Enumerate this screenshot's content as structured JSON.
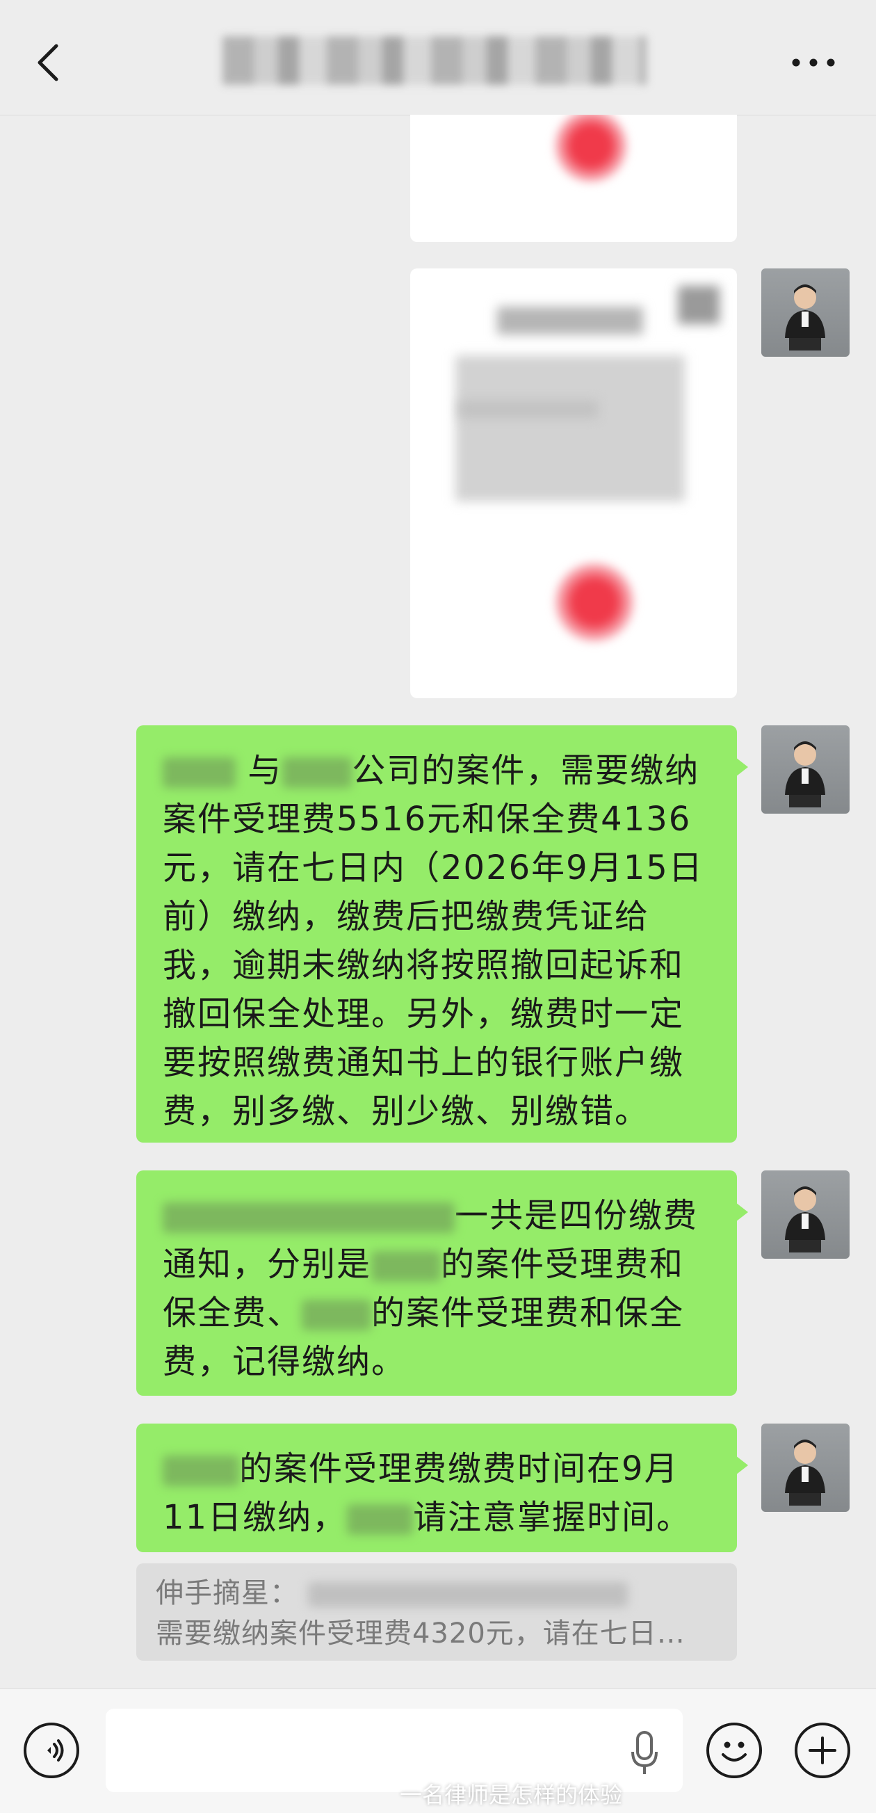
{
  "messages": [
    {
      "text_parts": [
        "与",
        "公司的案件，需要缴纳案件受理费5516元和保全费4136元，请在七日内（2026年9月15日前）缴纳，缴费后把缴费凭证给我，逾期未缴纳将按照撤回起诉和撤回保全处理。另外，缴费时一定要按照缴费通知书上的银行账户缴费，别多缴、别少缴、别缴错。"
      ]
    },
    {
      "text_parts": [
        "一共是四份缴费通知，分别是",
        "的案件受理费和保全费、",
        "的案件受理费和保全费，记得缴纳。"
      ]
    },
    {
      "text_parts": [
        "的案件受理费缴费时间在9月11日缴纳，",
        "请注意掌握时间。"
      ]
    }
  ],
  "quote": {
    "sender": "伸手摘星：",
    "line2": "需要缴纳案件受理费4320元，请在七日…"
  },
  "watermark": "一名律师是怎样的体验",
  "colors": {
    "bubble_green": "#95ec69",
    "background": "#ededed"
  },
  "icons": [
    "back-icon",
    "more-icon",
    "voice-icon",
    "mic-icon",
    "emoji-icon",
    "plus-icon"
  ]
}
